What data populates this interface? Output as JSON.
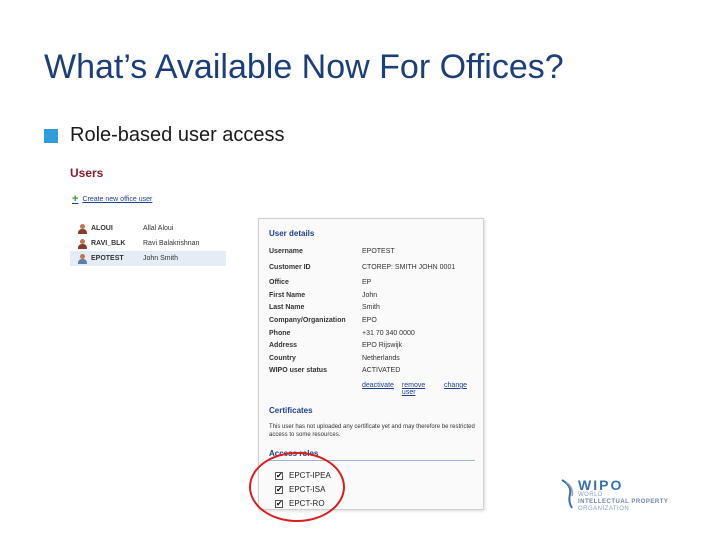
{
  "slide": {
    "title": "What’s Available Now For Offices?",
    "bullet": "Role-based user access"
  },
  "users": {
    "heading": "Users",
    "create_link": "Create new office user",
    "list": [
      {
        "id": "ALOUI",
        "name": "Allal Aloui"
      },
      {
        "id": "RAVI_BLK",
        "name": "Ravi Balakrishnan"
      },
      {
        "id": "EPOTEST",
        "name": "John Smith"
      }
    ]
  },
  "details": {
    "heading": "User details",
    "fields": [
      {
        "label": "Username",
        "value": "EPOTEST"
      },
      {
        "label": "Customer ID",
        "value": "CTOREP: SMITH JOHN 0001"
      },
      {
        "label": "Office",
        "value": "EP"
      },
      {
        "label": "First Name",
        "value": "John"
      },
      {
        "label": "Last Name",
        "value": "Smith"
      },
      {
        "label": "Company/Organization",
        "value": "EPO"
      },
      {
        "label": "Phone",
        "value": "+31 70 340 0000"
      },
      {
        "label": "Address",
        "value": "EPO Rijswijk"
      },
      {
        "label": "Country",
        "value": "Netherlands"
      },
      {
        "label": "WIPO user status",
        "value": "ACTIVATED"
      }
    ],
    "actions": [
      "deactivate",
      "remove user",
      "change"
    ],
    "certificates_heading": "Certificates",
    "certificates_text": "This user has not uploaded any certificate yet and may therefore be restricted access to some resources.",
    "access_heading": "Access roles",
    "roles": [
      {
        "label": "EPCT-IPEA",
        "checked": true
      },
      {
        "label": "EPCT-ISA",
        "checked": true
      },
      {
        "label": "EPCT-RO",
        "checked": true
      }
    ]
  },
  "logo": {
    "name": "WIPO",
    "line1": "WORLD",
    "line2": "INTELLECTUAL PROPERTY",
    "line3": "ORGANIZATION"
  },
  "colors": {
    "title": "#1c3f7a",
    "bullet": "#2f9ed8",
    "users_heading": "#8a1c2e",
    "link": "#1f3f8f",
    "highlight": "#d81e1e"
  }
}
